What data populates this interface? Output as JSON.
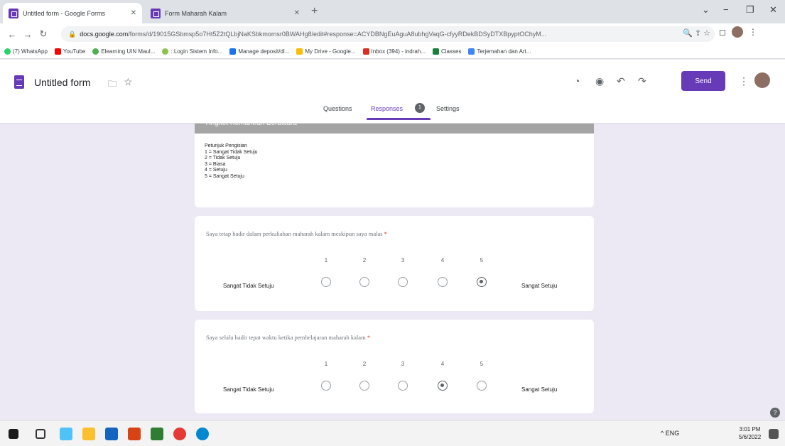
{
  "browser": {
    "tabs": [
      {
        "title": "Untitled form - Google Forms",
        "active": true
      },
      {
        "title": "Form Maharah Kalam",
        "active": false
      }
    ],
    "new_tab": "+",
    "url_host": "docs.google.com",
    "url_path": "/forms/d/19015GSbmsp5o7Ht5Z2tQLbjNaKSbkmomsr0BWAHg8/edit#response=ACYDBNgEuAguA8ubhgVaqG-cfyyRDekBDSyDTXBpyptOChyM...",
    "bookmarks": [
      "(7) WhatsApp",
      "YouTube",
      "Elearning UIN Maul...",
      "::Login Sistem Info...",
      "Manage deposit/dl...",
      "My Drive - Google...",
      "Inbox (394) - indrah...",
      "Classes",
      "Terjemahan dan Art..."
    ]
  },
  "forms": {
    "title": "Untitled form",
    "send_label": "Send",
    "tabs": {
      "questions": "Questions",
      "responses": "Responses",
      "settings": "Settings"
    },
    "responses_badge": "1"
  },
  "section": {
    "title": "Angket Kemahiran Berbicara",
    "instructions": [
      "Petunjuk Pengisian",
      "1 = Sangat Tidak Setuju",
      "2 = Tidak Setuju",
      "3 = Biasa",
      "4 = Setuju",
      "5 = Sangat Setuju"
    ]
  },
  "questions": [
    {
      "text": "Saya tetap hadir dalam perkuliahan maharah kalam meskipun saya malas",
      "required_mark": "*",
      "scale": [
        "1",
        "2",
        "3",
        "4",
        "5"
      ],
      "low_label": "Sangat Tidak Setuju",
      "high_label": "Sangat Setuju",
      "selected": 5
    },
    {
      "text": "Saya selalu hadir tepat waktu ketika pembelajaran maharah kalam",
      "required_mark": "*",
      "scale": [
        "1",
        "2",
        "3",
        "4",
        "5"
      ],
      "low_label": "Sangat Tidak Setuju",
      "high_label": "Sangat Setuju",
      "selected": 4
    }
  ],
  "taskbar": {
    "tray": "^ ENG",
    "time": "3:01 PM",
    "date": "5/6/2022"
  }
}
